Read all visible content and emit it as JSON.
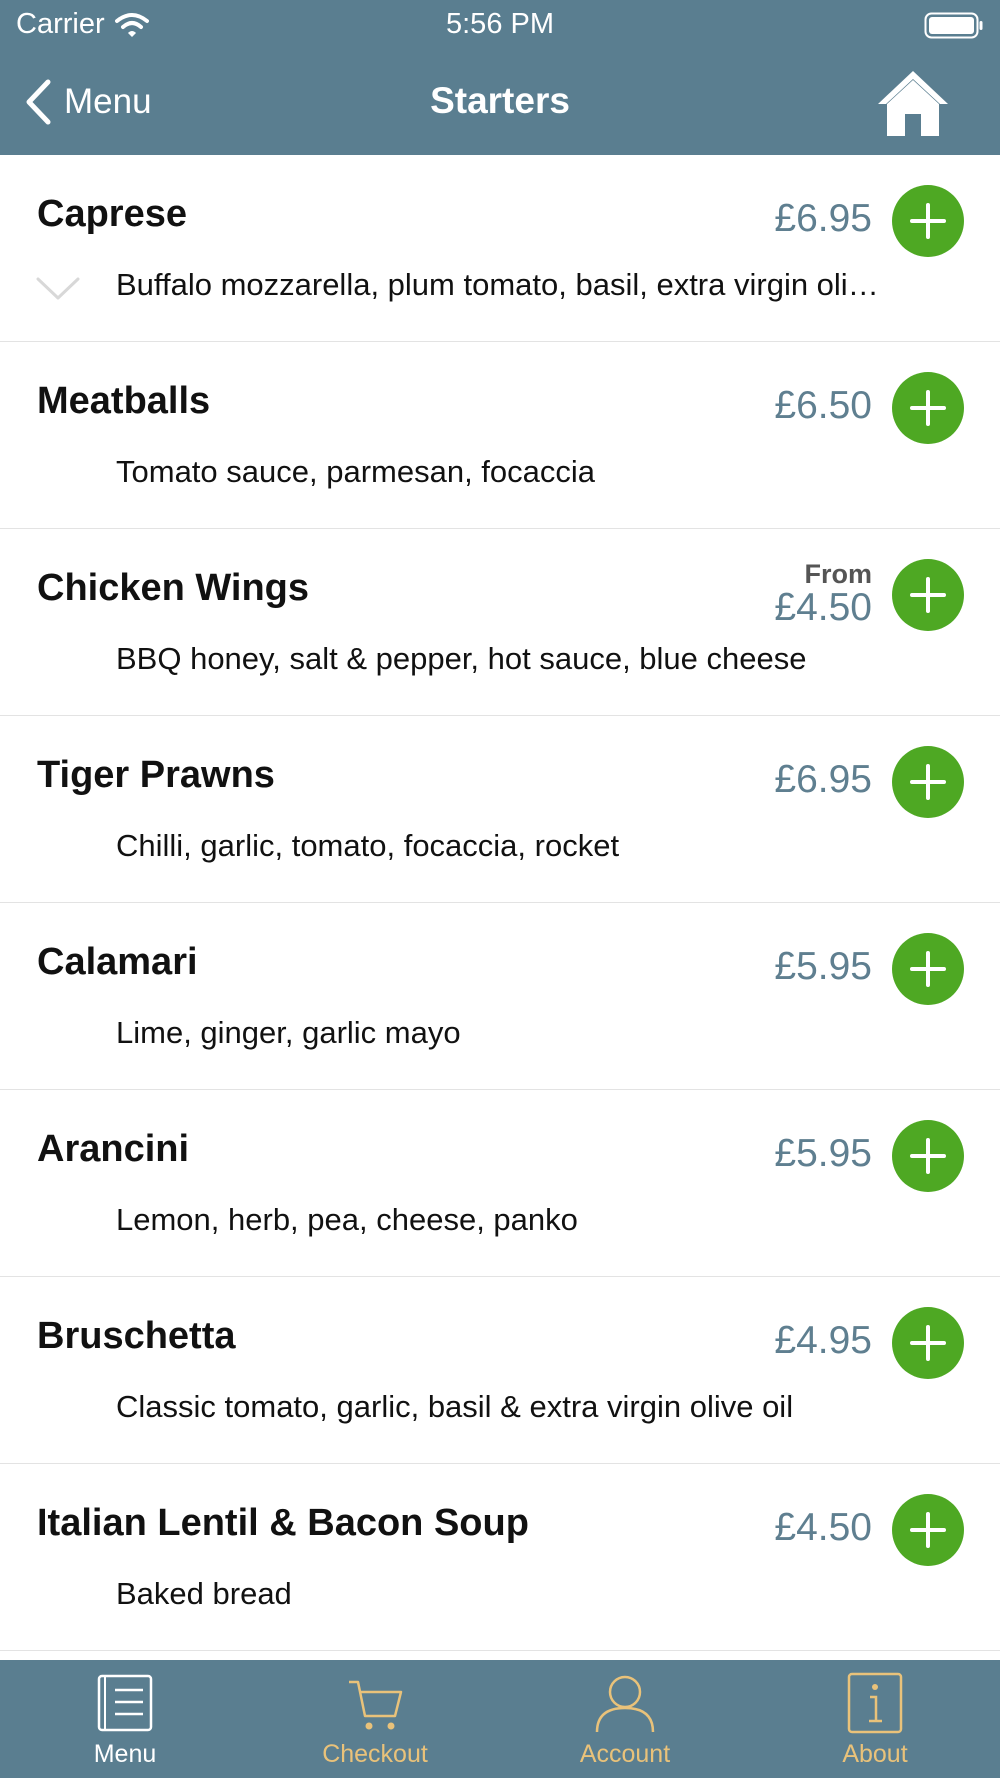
{
  "status_bar": {
    "carrier": "Carrier",
    "time": "5:56 PM"
  },
  "nav": {
    "back_label": "Menu",
    "title": "Starters"
  },
  "items": [
    {
      "name": "Caprese",
      "price": "£6.95",
      "description": "Buffalo mozzarella, plum tomato, basil, extra virgin oli…"
    },
    {
      "name": "Meatballs",
      "price": "£6.50",
      "description": "Tomato sauce, parmesan, focaccia"
    },
    {
      "name": "Chicken Wings",
      "price_prefix": "From",
      "price": "£4.50",
      "description": "BBQ honey, salt & pepper, hot sauce, blue cheese"
    },
    {
      "name": "Tiger Prawns",
      "price": "£6.95",
      "description": "Chilli, garlic, tomato, focaccia, rocket"
    },
    {
      "name": "Calamari",
      "price": "£5.95",
      "description": "Lime, ginger, garlic mayo"
    },
    {
      "name": "Arancini",
      "price": "£5.95",
      "description": "Lemon, herb, pea, cheese, panko"
    },
    {
      "name": "Bruschetta",
      "price": "£4.95",
      "description": "Classic tomato, garlic, basil & extra virgin olive oil"
    },
    {
      "name": "Italian Lentil & Bacon Soup",
      "price": "£4.50",
      "description": "Baked bread"
    }
  ],
  "tabs": [
    {
      "label": "Menu",
      "icon": "menu-icon",
      "active": true
    },
    {
      "label": "Checkout",
      "icon": "cart-icon",
      "active": false
    },
    {
      "label": "Account",
      "icon": "person-icon",
      "active": false
    },
    {
      "label": "About",
      "icon": "info-icon",
      "active": false
    }
  ],
  "colors": {
    "header": "#5a7e90",
    "add_button": "#4ea823",
    "price": "#5f7f90",
    "tab_inactive": "#e9c27a"
  }
}
